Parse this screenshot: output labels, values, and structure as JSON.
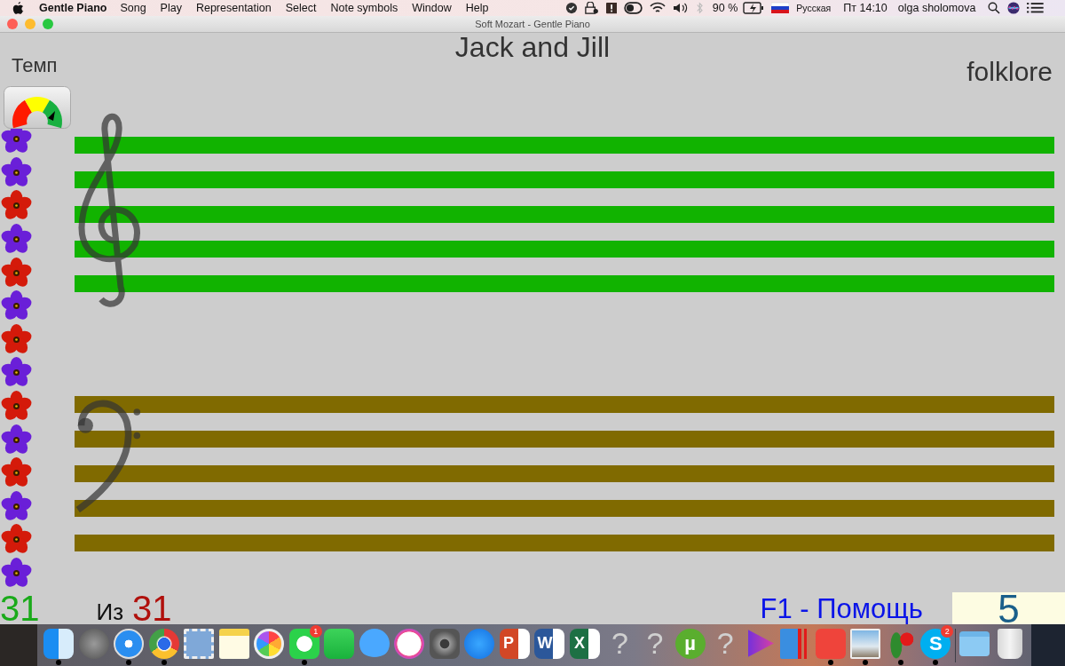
{
  "menu_bar": {
    "app_name": "Gentle Piano",
    "menus": [
      "Song",
      "Play",
      "Representation",
      "Select",
      "Note symbols",
      "Window",
      "Help"
    ],
    "battery": "90 %",
    "input_source": "Русская",
    "clock": "Пт 14:10",
    "user": "olga sholomova"
  },
  "window": {
    "title": "Soft Mozart - Gentle Piano"
  },
  "song": {
    "title": "Jack and Jill",
    "genre": "folklore"
  },
  "tempo": {
    "label": "Темп"
  },
  "flowers": [
    {
      "color": "#6a1fd8"
    },
    {
      "color": "#6a1fd8"
    },
    {
      "color": "#d41a0a"
    },
    {
      "color": "#6a1fd8"
    },
    {
      "color": "#d41a0a"
    },
    {
      "color": "#6a1fd8"
    },
    {
      "color": "#d41a0a"
    },
    {
      "color": "#6a1fd8"
    },
    {
      "color": "#d41a0a"
    },
    {
      "color": "#6a1fd8"
    },
    {
      "color": "#d41a0a"
    },
    {
      "color": "#6a1fd8"
    },
    {
      "color": "#d41a0a"
    },
    {
      "color": "#6a1fd8"
    }
  ],
  "staves": [
    {
      "kind": "treble",
      "color": "#11b300"
    },
    {
      "kind": "bass",
      "color": "#806a00"
    }
  ],
  "footer": {
    "current": "31",
    "of_label": "Из",
    "total": "31",
    "help": "F1 - Помощь",
    "score": "5"
  },
  "dock": [
    {
      "kind": "finder",
      "running": true
    },
    {
      "kind": "launchpad",
      "running": false
    },
    {
      "kind": "safari",
      "running": true
    },
    {
      "kind": "chrome",
      "running": true
    },
    {
      "kind": "mail",
      "running": false
    },
    {
      "kind": "notes",
      "running": false
    },
    {
      "kind": "photos",
      "running": false
    },
    {
      "kind": "whatsapp",
      "running": true,
      "badge": "1"
    },
    {
      "kind": "facetime",
      "running": false
    },
    {
      "kind": "messages",
      "running": false
    },
    {
      "kind": "music",
      "running": false
    },
    {
      "kind": "settings",
      "running": false
    },
    {
      "kind": "appstore",
      "running": false
    },
    {
      "kind": "powerpoint",
      "running": false,
      "label": "P"
    },
    {
      "kind": "word",
      "running": false,
      "label": "W"
    },
    {
      "kind": "excel",
      "running": false,
      "label": "X"
    },
    {
      "kind": "unknown",
      "running": false,
      "label": "?"
    },
    {
      "kind": "unknown",
      "running": false,
      "label": "?"
    },
    {
      "kind": "torrent",
      "running": false,
      "label": "µ"
    },
    {
      "kind": "unknown",
      "running": false,
      "label": "?"
    },
    {
      "kind": "player",
      "running": false
    },
    {
      "kind": "parallels",
      "running": false
    },
    {
      "kind": "anydesk",
      "running": true
    },
    {
      "kind": "preview",
      "running": true
    },
    {
      "kind": "softmozart",
      "running": true
    },
    {
      "kind": "skype",
      "running": true,
      "badge": "2",
      "label": "S"
    },
    {
      "kind": "separator"
    },
    {
      "kind": "folder",
      "running": false
    },
    {
      "kind": "trash",
      "running": false
    }
  ]
}
